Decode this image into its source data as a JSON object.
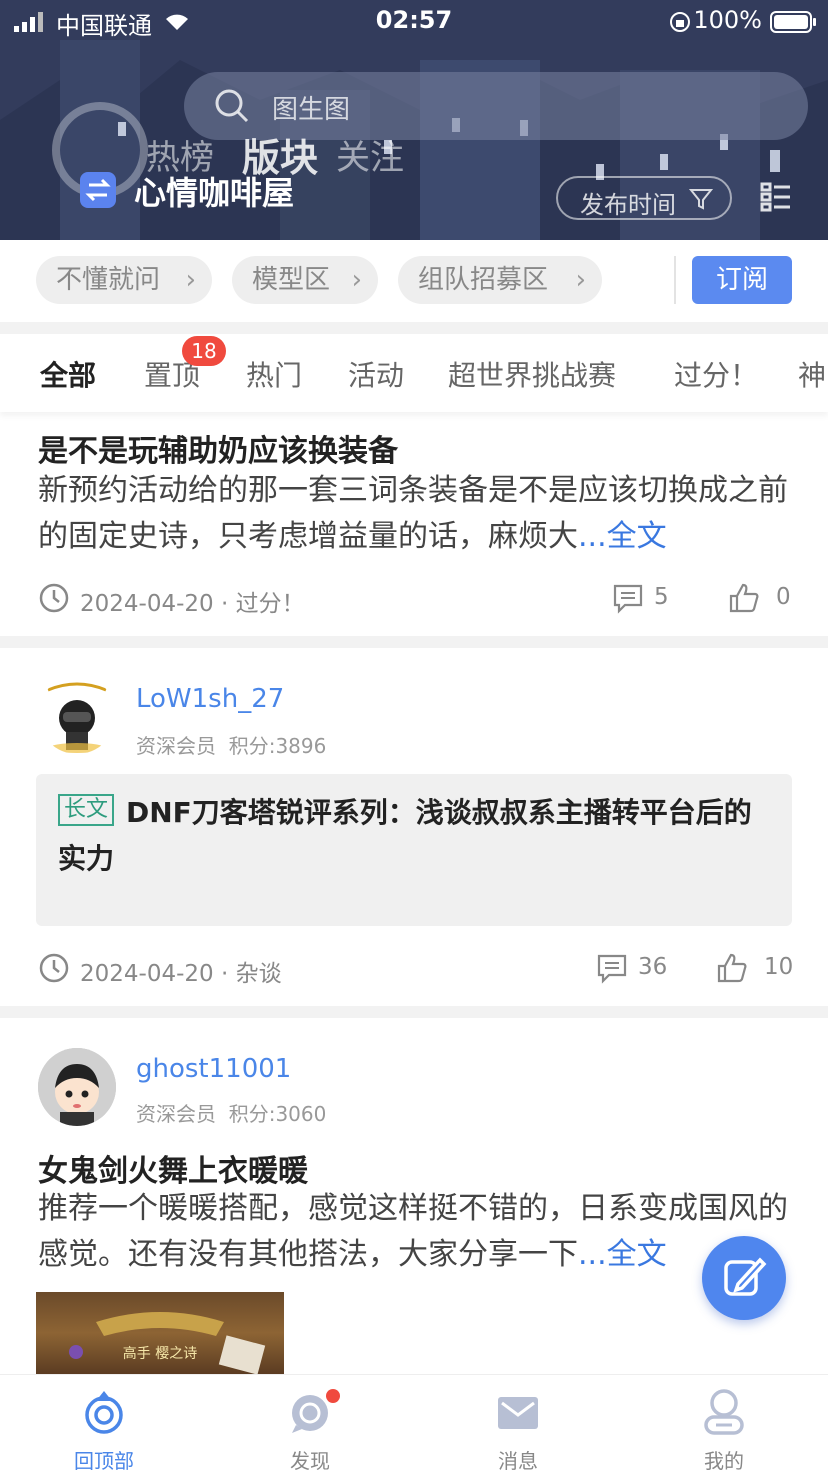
{
  "status_bar": {
    "carrier": "中国联通",
    "time": "02:57",
    "battery": "100%"
  },
  "header": {
    "search_placeholder": "图生图",
    "tabs": [
      "热榜",
      "版块",
      "关注"
    ],
    "section_name": "心情咖啡屋",
    "time_filter": "发布时间"
  },
  "quick_sections": {
    "chips": [
      "不懂就问",
      "模型区",
      "组队招募区"
    ],
    "subscribe_label": "订阅"
  },
  "category_tabs": {
    "items": [
      "全部",
      "置顶",
      "热门",
      "活动",
      "超世界挑战赛",
      "过分！",
      "神"
    ],
    "pinned_badge": "18"
  },
  "posts": [
    {
      "title": "是不是玩辅助奶应该换装备",
      "body": "新预约活动给的那一套三词条装备是不是应该切换成之前的固定史诗，只考虑增益量的话，麻烦大",
      "more": "...全文",
      "date": "2024-04-20",
      "section": "· 过分！",
      "comments": "5",
      "likes": "0"
    },
    {
      "user": "LoW1sh_27",
      "level": "资深会员",
      "points": "积分:3896",
      "tag": "长文",
      "title": "DNF刀客塔锐评系列：浅谈叔叔系主播转平台后的实力",
      "date": "2024-04-20",
      "section": "· 杂谈",
      "comments": "36",
      "likes": "10"
    },
    {
      "user": "ghost11001",
      "level": "资深会员",
      "points": "积分:3060",
      "title": "女鬼剑火舞上衣暖暖",
      "body": "推荐一个暖暖搭配，感觉这样挺不错的，日系变成国风的感觉。还有没有其他搭法，大家分享一下",
      "more": "...全文",
      "thumb_caption": "高手 樱之诗"
    }
  ],
  "bottom_nav": [
    "回顶部",
    "发现",
    "消息",
    "我的"
  ],
  "colors": {
    "accent": "#4a86e8",
    "badge": "#f04a3e",
    "long_tag": "#3aa68a"
  }
}
